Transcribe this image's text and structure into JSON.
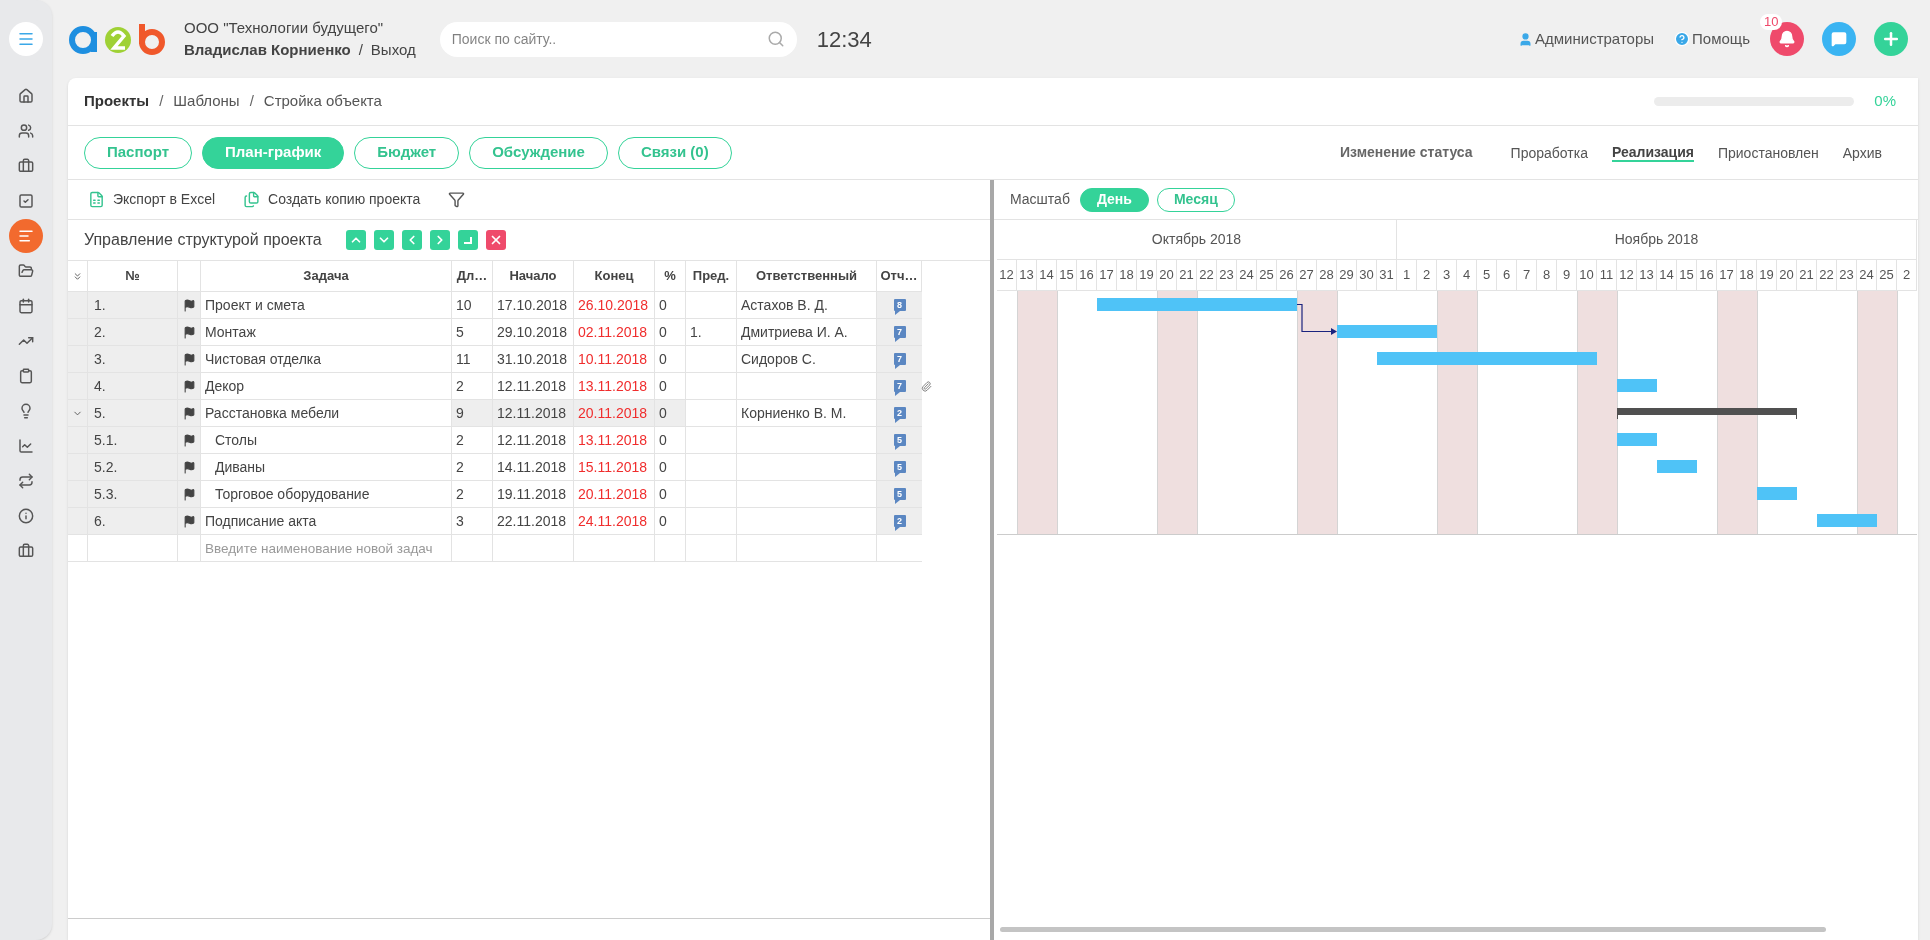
{
  "sidebar": {
    "items": [
      {
        "selected": false
      },
      {
        "selected": false
      },
      {
        "selected": false
      },
      {
        "selected": false
      },
      {
        "selected": true
      },
      {
        "selected": false
      },
      {
        "selected": false
      },
      {
        "selected": false
      },
      {
        "selected": false
      },
      {
        "selected": false
      },
      {
        "selected": false
      },
      {
        "selected": false
      },
      {
        "selected": false
      },
      {
        "selected": false
      }
    ]
  },
  "header": {
    "company": "ООО \"Технологии будущего\"",
    "user": "Владислав Корниенко",
    "logout_separator": "/",
    "logout": "Выход",
    "search": {
      "placeholder": "Поиск по сайту.."
    },
    "time": "12:34",
    "role": "Администраторы",
    "help": "Помощь",
    "notifications": "10"
  },
  "breadcrumb": [
    {
      "label": "Проекты"
    },
    {
      "separator": "/",
      "label": "Шаблоны"
    },
    {
      "separator": "/",
      "label": "Стройка объекта"
    }
  ],
  "progress": {
    "level": 0,
    "reading": "0%"
  },
  "tabs": [
    {
      "label": "Паспорт",
      "selected": false
    },
    {
      "label": "План-график",
      "selected": true
    },
    {
      "label": "Бюджет",
      "selected": false
    },
    {
      "label": "Обсуждение",
      "selected": false
    },
    {
      "label": "Связи (0)",
      "selected": false
    }
  ],
  "status": {
    "label": "Изменение статуса",
    "options": [
      {
        "label": "Проработка",
        "selected": false
      },
      {
        "label": "Реализация",
        "selected": true
      },
      {
        "label": "Приостановлен",
        "selected": false
      },
      {
        "label": "Архив",
        "selected": false
      }
    ]
  },
  "toolbar": {
    "export": "Экспорт в Excel",
    "copy": "Создать копию проекта"
  },
  "structure": {
    "label": "Управление структурой проекта",
    "buttons": [
      {
        "kind": "up"
      },
      {
        "kind": "down"
      },
      {
        "kind": "left"
      },
      {
        "kind": "right"
      },
      {
        "kind": "corner"
      },
      {
        "kind": "delete"
      }
    ]
  },
  "table": {
    "columns": [
      "№",
      "Задача",
      "Дл…",
      "Начало",
      "Конец",
      "%",
      "Пред.",
      "Ответственный",
      "Отч…"
    ],
    "rows": [
      {
        "kind": "task",
        "number": "1.",
        "task": "Проект и смета",
        "duration": "10",
        "start": "17.10.2018",
        "end": "26.10.2018",
        "overdue": true,
        "percent": "0",
        "owner": "Астахов В. Д.",
        "reports": "8",
        "attachment": false
      },
      {
        "kind": "task",
        "number": "2.",
        "task": "Монтаж",
        "duration": "5",
        "start": "29.10.2018",
        "end": "02.11.2018",
        "overdue": true,
        "percent": "0",
        "pred": "1.",
        "owner": "Дмитриева И. А.",
        "reports": "7",
        "attachment": false
      },
      {
        "kind": "task",
        "number": "3.",
        "task": "Чистовая отделка",
        "duration": "11",
        "start": "31.10.2018",
        "end": "10.11.2018",
        "overdue": true,
        "percent": "0",
        "owner": "Сидоров С.",
        "reports": "7",
        "attachment": false
      },
      {
        "kind": "task",
        "number": "4.",
        "task": "Декор",
        "duration": "2",
        "start": "12.11.2018",
        "end": "13.11.2018",
        "overdue": true,
        "percent": "0",
        "reports": "7",
        "attachment": true
      },
      {
        "kind": "summary",
        "expanded": true,
        "number": "5.",
        "task": "Расстановка мебели",
        "duration": "9",
        "start": "12.11.2018",
        "end": "20.11.2018",
        "overdue": true,
        "percent": "0",
        "owner": "Корниенко В. М.",
        "reports": "2",
        "attachment": false,
        "children": [
          {
            "kind": "task",
            "number": "5.1.",
            "task": "Столы",
            "duration": "2",
            "start": "12.11.2018",
            "end": "13.11.2018",
            "overdue": true,
            "percent": "0",
            "reports": "5",
            "attachment": false
          },
          {
            "kind": "task",
            "number": "5.2.",
            "task": "Диваны",
            "duration": "2",
            "start": "14.11.2018",
            "end": "15.11.2018",
            "overdue": true,
            "percent": "0",
            "reports": "5",
            "attachment": false
          },
          {
            "kind": "task",
            "number": "5.3.",
            "task": "Торговое оборудование",
            "duration": "2",
            "start": "19.11.2018",
            "end": "20.11.2018",
            "overdue": true,
            "percent": "0",
            "reports": "5",
            "attachment": false
          }
        ]
      },
      {
        "kind": "task",
        "number": "6.",
        "task": "Подписание акта",
        "duration": "3",
        "start": "22.11.2018",
        "end": "24.11.2018",
        "overdue": true,
        "percent": "0",
        "reports": "2",
        "attachment": false
      }
    ],
    "new_row": {
      "placeholder": "Введите наименование новой задач"
    }
  },
  "gantt": {
    "scale_label": "Масштаб",
    "scales": [
      {
        "label": "День",
        "selected": true
      },
      {
        "label": "Месяц",
        "selected": false
      }
    ],
    "months": [
      {
        "label": "Октябрь 2018",
        "days": [
          {
            "label": "12",
            "weekend": false
          },
          {
            "label": "13",
            "weekend": true
          },
          {
            "label": "14",
            "weekend": true
          },
          {
            "label": "15",
            "weekend": false
          },
          {
            "label": "16",
            "weekend": false
          },
          {
            "label": "17",
            "weekend": false
          },
          {
            "label": "18",
            "weekend": false
          },
          {
            "label": "19",
            "weekend": false
          },
          {
            "label": "20",
            "weekend": true
          },
          {
            "label": "21",
            "weekend": true
          },
          {
            "label": "22",
            "weekend": false
          },
          {
            "label": "23",
            "weekend": false
          },
          {
            "label": "24",
            "weekend": false
          },
          {
            "label": "25",
            "weekend": false
          },
          {
            "label": "26",
            "weekend": false
          },
          {
            "label": "27",
            "weekend": true
          },
          {
            "label": "28",
            "weekend": true
          },
          {
            "label": "29",
            "weekend": false
          },
          {
            "label": "30",
            "weekend": false
          },
          {
            "label": "31",
            "weekend": false
          }
        ]
      },
      {
        "label": "Ноябрь 2018",
        "days": [
          {
            "label": "1",
            "weekend": false
          },
          {
            "label": "2",
            "weekend": false
          },
          {
            "label": "3",
            "weekend": true
          },
          {
            "label": "4",
            "weekend": true
          },
          {
            "label": "5",
            "weekend": false
          },
          {
            "label": "6",
            "weekend": false
          },
          {
            "label": "7",
            "weekend": false
          },
          {
            "label": "8",
            "weekend": false
          },
          {
            "label": "9",
            "weekend": false
          },
          {
            "label": "10",
            "weekend": true
          },
          {
            "label": "11",
            "weekend": true
          },
          {
            "label": "12",
            "weekend": false
          },
          {
            "label": "13",
            "weekend": false
          },
          {
            "label": "14",
            "weekend": false
          },
          {
            "label": "15",
            "weekend": false
          },
          {
            "label": "16",
            "weekend": false
          },
          {
            "label": "17",
            "weekend": true
          },
          {
            "label": "18",
            "weekend": true
          },
          {
            "label": "19",
            "weekend": false
          },
          {
            "label": "20",
            "weekend": false
          },
          {
            "label": "21",
            "weekend": false
          },
          {
            "label": "22",
            "weekend": false
          },
          {
            "label": "23",
            "weekend": false
          },
          {
            "label": "24",
            "weekend": true
          },
          {
            "label": "25",
            "weekend": true
          },
          {
            "label": "2",
            "weekend": false
          }
        ]
      }
    ]
  }
}
